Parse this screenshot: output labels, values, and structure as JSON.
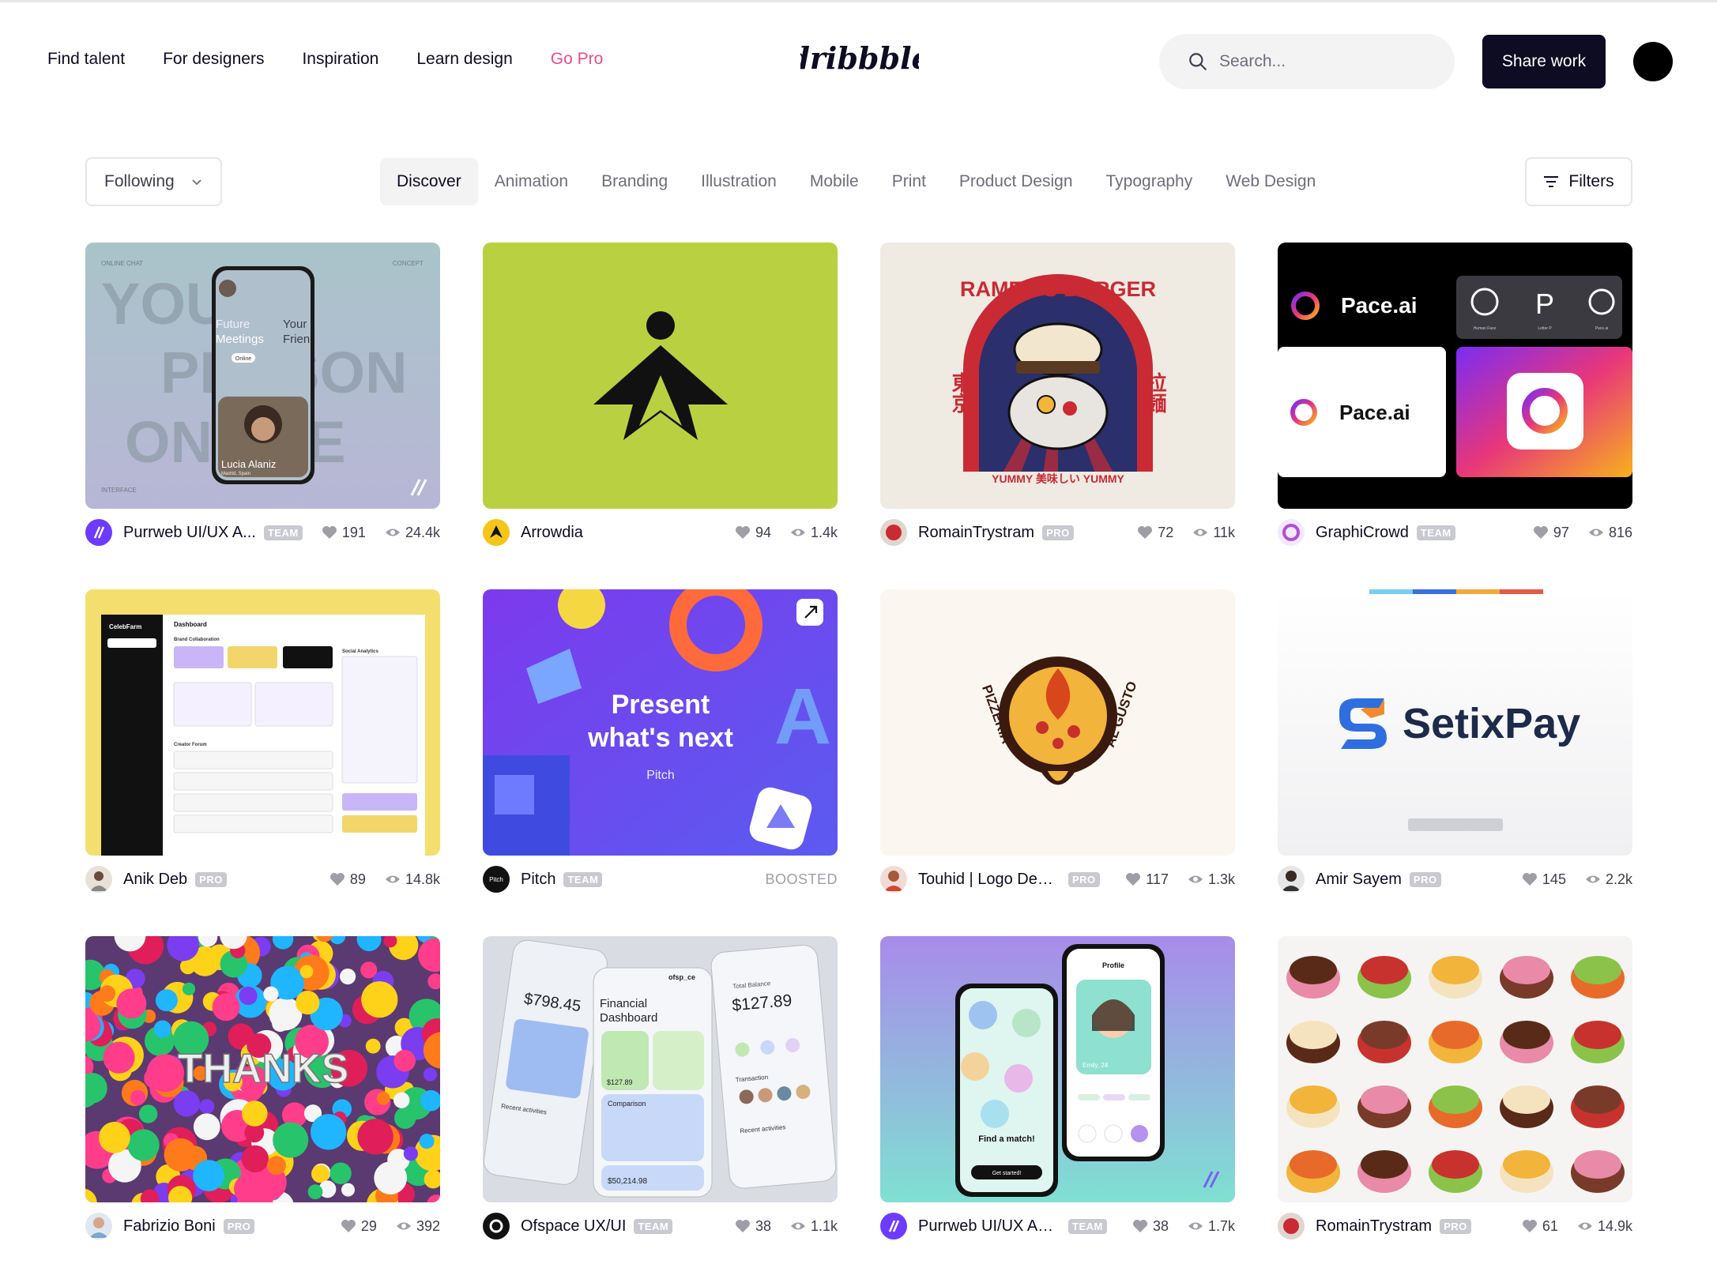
{
  "header": {
    "nav": [
      {
        "label": "Find talent"
      },
      {
        "label": "For designers"
      },
      {
        "label": "Inspiration"
      },
      {
        "label": "Learn design"
      },
      {
        "label": "Go Pro"
      }
    ],
    "logo_text": "dribbble",
    "search_placeholder": "Search...",
    "share_label": "Share work",
    "accent": "#ea4c89"
  },
  "filter_bar": {
    "following_label": "Following",
    "categories": [
      "Discover",
      "Animation",
      "Branding",
      "Illustration",
      "Mobile",
      "Print",
      "Product Design",
      "Typography",
      "Web Design"
    ],
    "active_category": "Discover",
    "filters_label": "Filters"
  },
  "shots": [
    {
      "author": "Purrweb UI/UX A...",
      "badge": "TEAM",
      "likes": "191",
      "views": "24.4k",
      "art": {
        "top_left": "ONLINE CHAT",
        "top_right": "CONCEPT",
        "bottom_left": "INTERFACE",
        "big1": "YOUR",
        "big2": "PERSON",
        "big3": "ONLINE",
        "meet1": "Future",
        "meet2": "Meetings",
        "meet3": "Your",
        "meet4": "Frien",
        "person": "Lucia Alaniz",
        "person_loc": "Madrid, Spain",
        "pill": "Online"
      }
    },
    {
      "author": "Arrowdia",
      "badge": "",
      "likes": "94",
      "views": "1.4k"
    },
    {
      "author": "RomainTrystram",
      "badge": "PRO",
      "likes": "72",
      "views": "11k",
      "art": {
        "arc": "RAMEN'S BURGER",
        "left_cjk": "東京",
        "right_cjk": "拉麺",
        "bottom": "YUMMY 美味しい YUMMY"
      }
    },
    {
      "author": "GraphiCrowd",
      "badge": "TEAM",
      "likes": "97",
      "views": "816",
      "art": {
        "brand": "Pace.ai",
        "icon1": "Human Face",
        "icon2": "Letter P",
        "icon3": "Pace.ai"
      }
    },
    {
      "author": "Anik Deb",
      "badge": "PRO",
      "likes": "89",
      "views": "14.8k",
      "art": {
        "app": "CelebFarm",
        "title": "Dashboard",
        "section": "Brand Collaboration",
        "social": "Social Analytics",
        "forum": "Creator Forum"
      }
    },
    {
      "author": "Pitch",
      "badge": "TEAM",
      "likes": "",
      "views": "",
      "boosted": "BOOSTED",
      "art": {
        "headline1": "Present",
        "headline2": "what's next",
        "brand": "Pitch"
      }
    },
    {
      "author": "Touhid | Logo Desig...",
      "badge": "PRO",
      "likes": "117",
      "views": "1.3k",
      "art": {
        "left": "PIZZERIA",
        "right": "AL GUSTO"
      }
    },
    {
      "author": "Amir Sayem",
      "badge": "PRO",
      "likes": "145",
      "views": "2.2k",
      "art": {
        "brand": "SetixPay"
      }
    },
    {
      "author": "Fabrizio Boni",
      "badge": "PRO",
      "likes": "29",
      "views": "392",
      "art": {
        "word": "THANKS"
      }
    },
    {
      "author": "Ofspace UX/UI",
      "badge": "TEAM",
      "likes": "38",
      "views": "1.1k",
      "art": {
        "amount1": "$798.45",
        "title": "Financial Dashboard",
        "amount2": "$127.89",
        "brand": "ofsp_ce",
        "recent": "Recent activities",
        "comparison": "Comparison",
        "profit": "$50,214.98",
        "total_balance": "Total Balance",
        "transaction": "Transaction"
      }
    },
    {
      "author": "Purrweb UI/UX Age...",
      "badge": "TEAM",
      "likes": "38",
      "views": "1.7k",
      "art": {
        "match": "Find a match!",
        "profile": "Profile",
        "cta": "Get started!",
        "name": "Emily, 24"
      }
    },
    {
      "author": "RomainTrystram",
      "badge": "PRO",
      "likes": "61",
      "views": "14.9k"
    }
  ]
}
